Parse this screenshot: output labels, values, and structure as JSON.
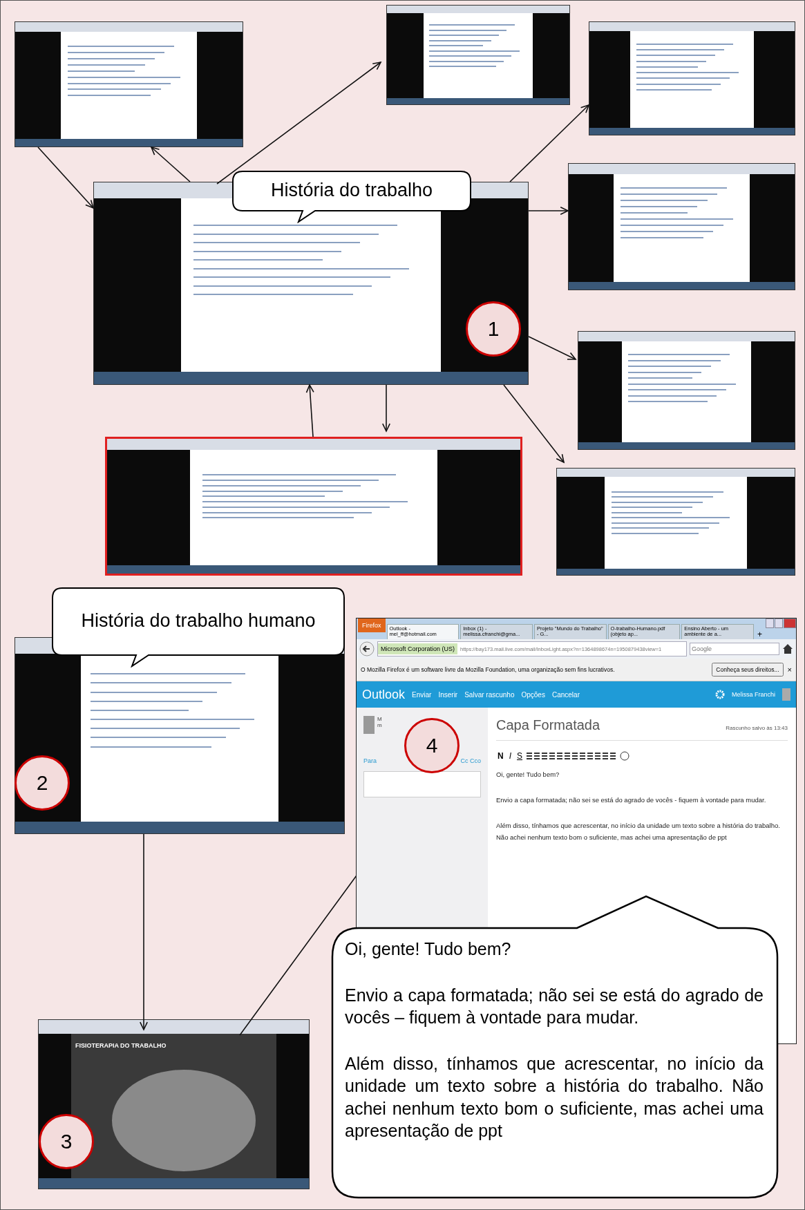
{
  "thumbnails": [
    {
      "kind": "page",
      "highlighted": false
    },
    {
      "kind": "page",
      "highlighted": false
    },
    {
      "kind": "page",
      "highlighted": false
    },
    {
      "kind": "page",
      "highlighted": false
    },
    {
      "kind": "page",
      "highlighted": false
    },
    {
      "kind": "page",
      "highlighted": false
    },
    {
      "kind": "page",
      "highlighted": true
    },
    {
      "kind": "page",
      "highlighted": false
    },
    {
      "kind": "page",
      "highlighted": false
    },
    {
      "kind": "slide",
      "highlighted": false,
      "title": "FISIOTERAPIA DO TRABALHO"
    }
  ],
  "callouts": [
    "História do trabalho",
    "História do trabalho humano"
  ],
  "step_markers": [
    "1",
    "2",
    "3",
    "4"
  ],
  "email_window": {
    "firefox_button": "Firefox",
    "tabs": [
      {
        "label": "Outlook - mel_ff@hotmail.com",
        "selected": true
      },
      {
        "label": "Inbox (1) - melissa.cfranchi@gma...",
        "selected": false
      },
      {
        "label": "Projeto \"Mundo do Trabalho\" - G...",
        "selected": false
      },
      {
        "label": "O-trabalho-Humano.pdf (objeto ap...",
        "selected": false
      },
      {
        "label": "Ensino Aberto - um ambiente de a...",
        "selected": false
      }
    ],
    "new_tab": "+",
    "site_identity": "Microsoft Corporation (US)",
    "url": "https://bay173.mail.live.com/mail/InboxLight.aspx?n=1364898674n=1950879438view=1",
    "search_placeholder": "Google",
    "info_bar": {
      "message": "O Mozilla Firefox é um software livre da Mozilla Foundation, uma organização sem fins lucrativos.",
      "button": "Conheça seus direitos...",
      "close": "×"
    },
    "app_bar": {
      "brand": "Outlook",
      "actions": [
        "Enviar",
        "Inserir",
        "Salvar rascunho",
        "Opções",
        "Cancelar"
      ],
      "user": "Melissa Franchi"
    },
    "sender": {
      "line_1": "M",
      "line_2": "m"
    },
    "to_label": "Para",
    "cc_label": "Cc Cco",
    "subject": "Capa Formatada",
    "draft_status": "Rascunho salvo às 13:43",
    "format_buttons": [
      "N",
      "I",
      "S"
    ],
    "body": [
      "Oi, gente! Tudo bem?",
      "Envio a capa formatada; não sei se está do agrado de vocês - fiquem à vontade para mudar.",
      "Além disso, tínhamos que acrescentar, no início da unidade um texto sobre a história do trabalho. Não achei nenhum texto bom o suficiente, mas achei uma apresentação de ppt"
    ]
  },
  "reply_bubble": [
    "Oi, gente! Tudo bem?",
    "Envio a capa formatada; não sei se está do agrado de vocês – fiquem à vontade para mudar.",
    "Além disso, tínhamos que acrescentar, no início da unidade um texto sobre a história do trabalho. Não achei nenhum texto bom o suficiente, mas achei uma apresentação de ppt"
  ]
}
